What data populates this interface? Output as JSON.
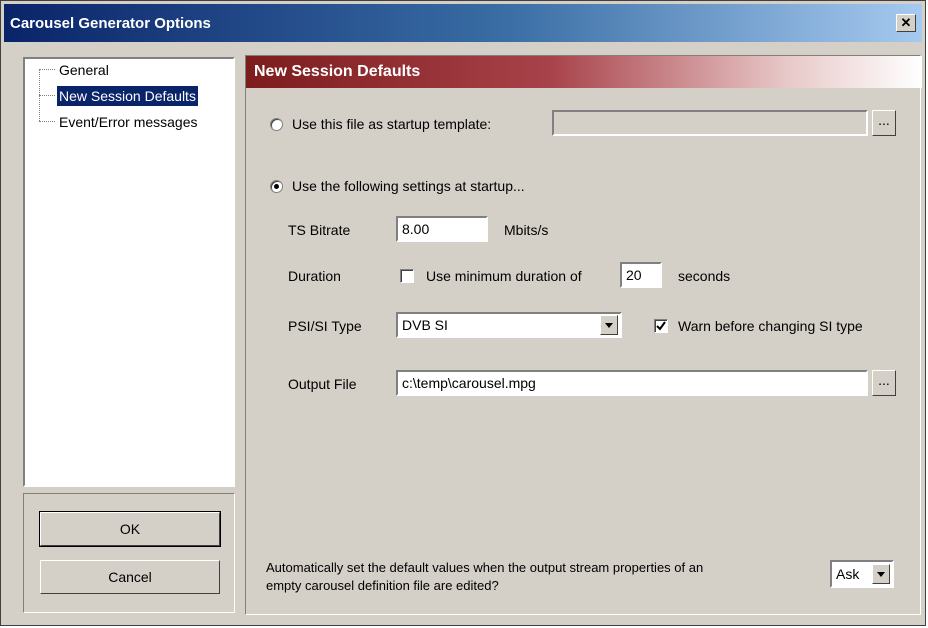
{
  "window": {
    "title": "Carousel Generator Options",
    "close_label": "✕"
  },
  "tree": {
    "items": [
      {
        "label": "General"
      },
      {
        "label": "New Session Defaults"
      },
      {
        "label": "Event/Error messages"
      }
    ],
    "selected": "New Session Defaults"
  },
  "buttons": {
    "ok": "OK",
    "cancel": "Cancel"
  },
  "panel": {
    "header": "New Session Defaults",
    "startup_template_label": "Use this file as startup template:",
    "startup_template_value": "",
    "browse_label": "...",
    "use_settings_label": "Use the following settings at startup...",
    "mode_selected": "settings",
    "ts_bitrate_label": "TS Bitrate",
    "ts_bitrate_value": "8.00",
    "ts_bitrate_unit": "Mbits/s",
    "duration_label": "Duration",
    "min_duration_label": "Use minimum duration of",
    "min_duration_checked": false,
    "min_duration_value": "20",
    "min_duration_unit": "seconds",
    "psi_label": "PSI/SI Type",
    "psi_value": "DVB SI",
    "warn_label": "Warn before changing SI type",
    "warn_checked": true,
    "output_label": "Output File",
    "output_value": "c:\\temp\\carousel.mpg",
    "auto_text_line1": "Automatically set the default values when the output stream properties of an",
    "auto_text_line2": "empty carousel definition file are edited?",
    "auto_value": "Ask"
  },
  "colors": {
    "titlebar": "#0a246a",
    "header": "#7c1c1c",
    "face": "#d4d0c8",
    "selection": "#0a246a"
  }
}
